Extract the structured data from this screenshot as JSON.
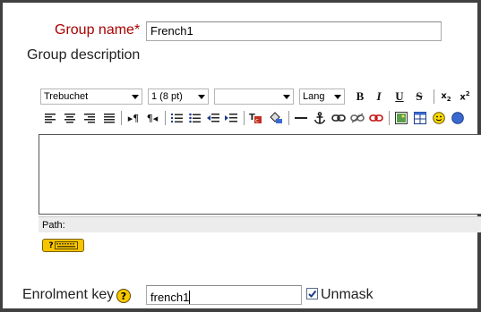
{
  "form": {
    "group_name_label": "Group name",
    "required_mark": "*",
    "group_name_value": "French1",
    "group_description_label": "Group description",
    "enrolment_key_label": "Enrolment key",
    "enrolment_key_value": "french1",
    "unmask_label": "Unmask",
    "unmask_checked": true
  },
  "editor": {
    "font_family": "Trebuchet",
    "font_size": "1 (8 pt)",
    "style": "",
    "lang": "Lang",
    "path_label": "Path:",
    "content": ""
  },
  "icons": {
    "help": "help-icon",
    "keyboard": "keyboard-icon"
  },
  "colors": {
    "required_label": "#aa0000",
    "help_icon": "#f8c800"
  }
}
